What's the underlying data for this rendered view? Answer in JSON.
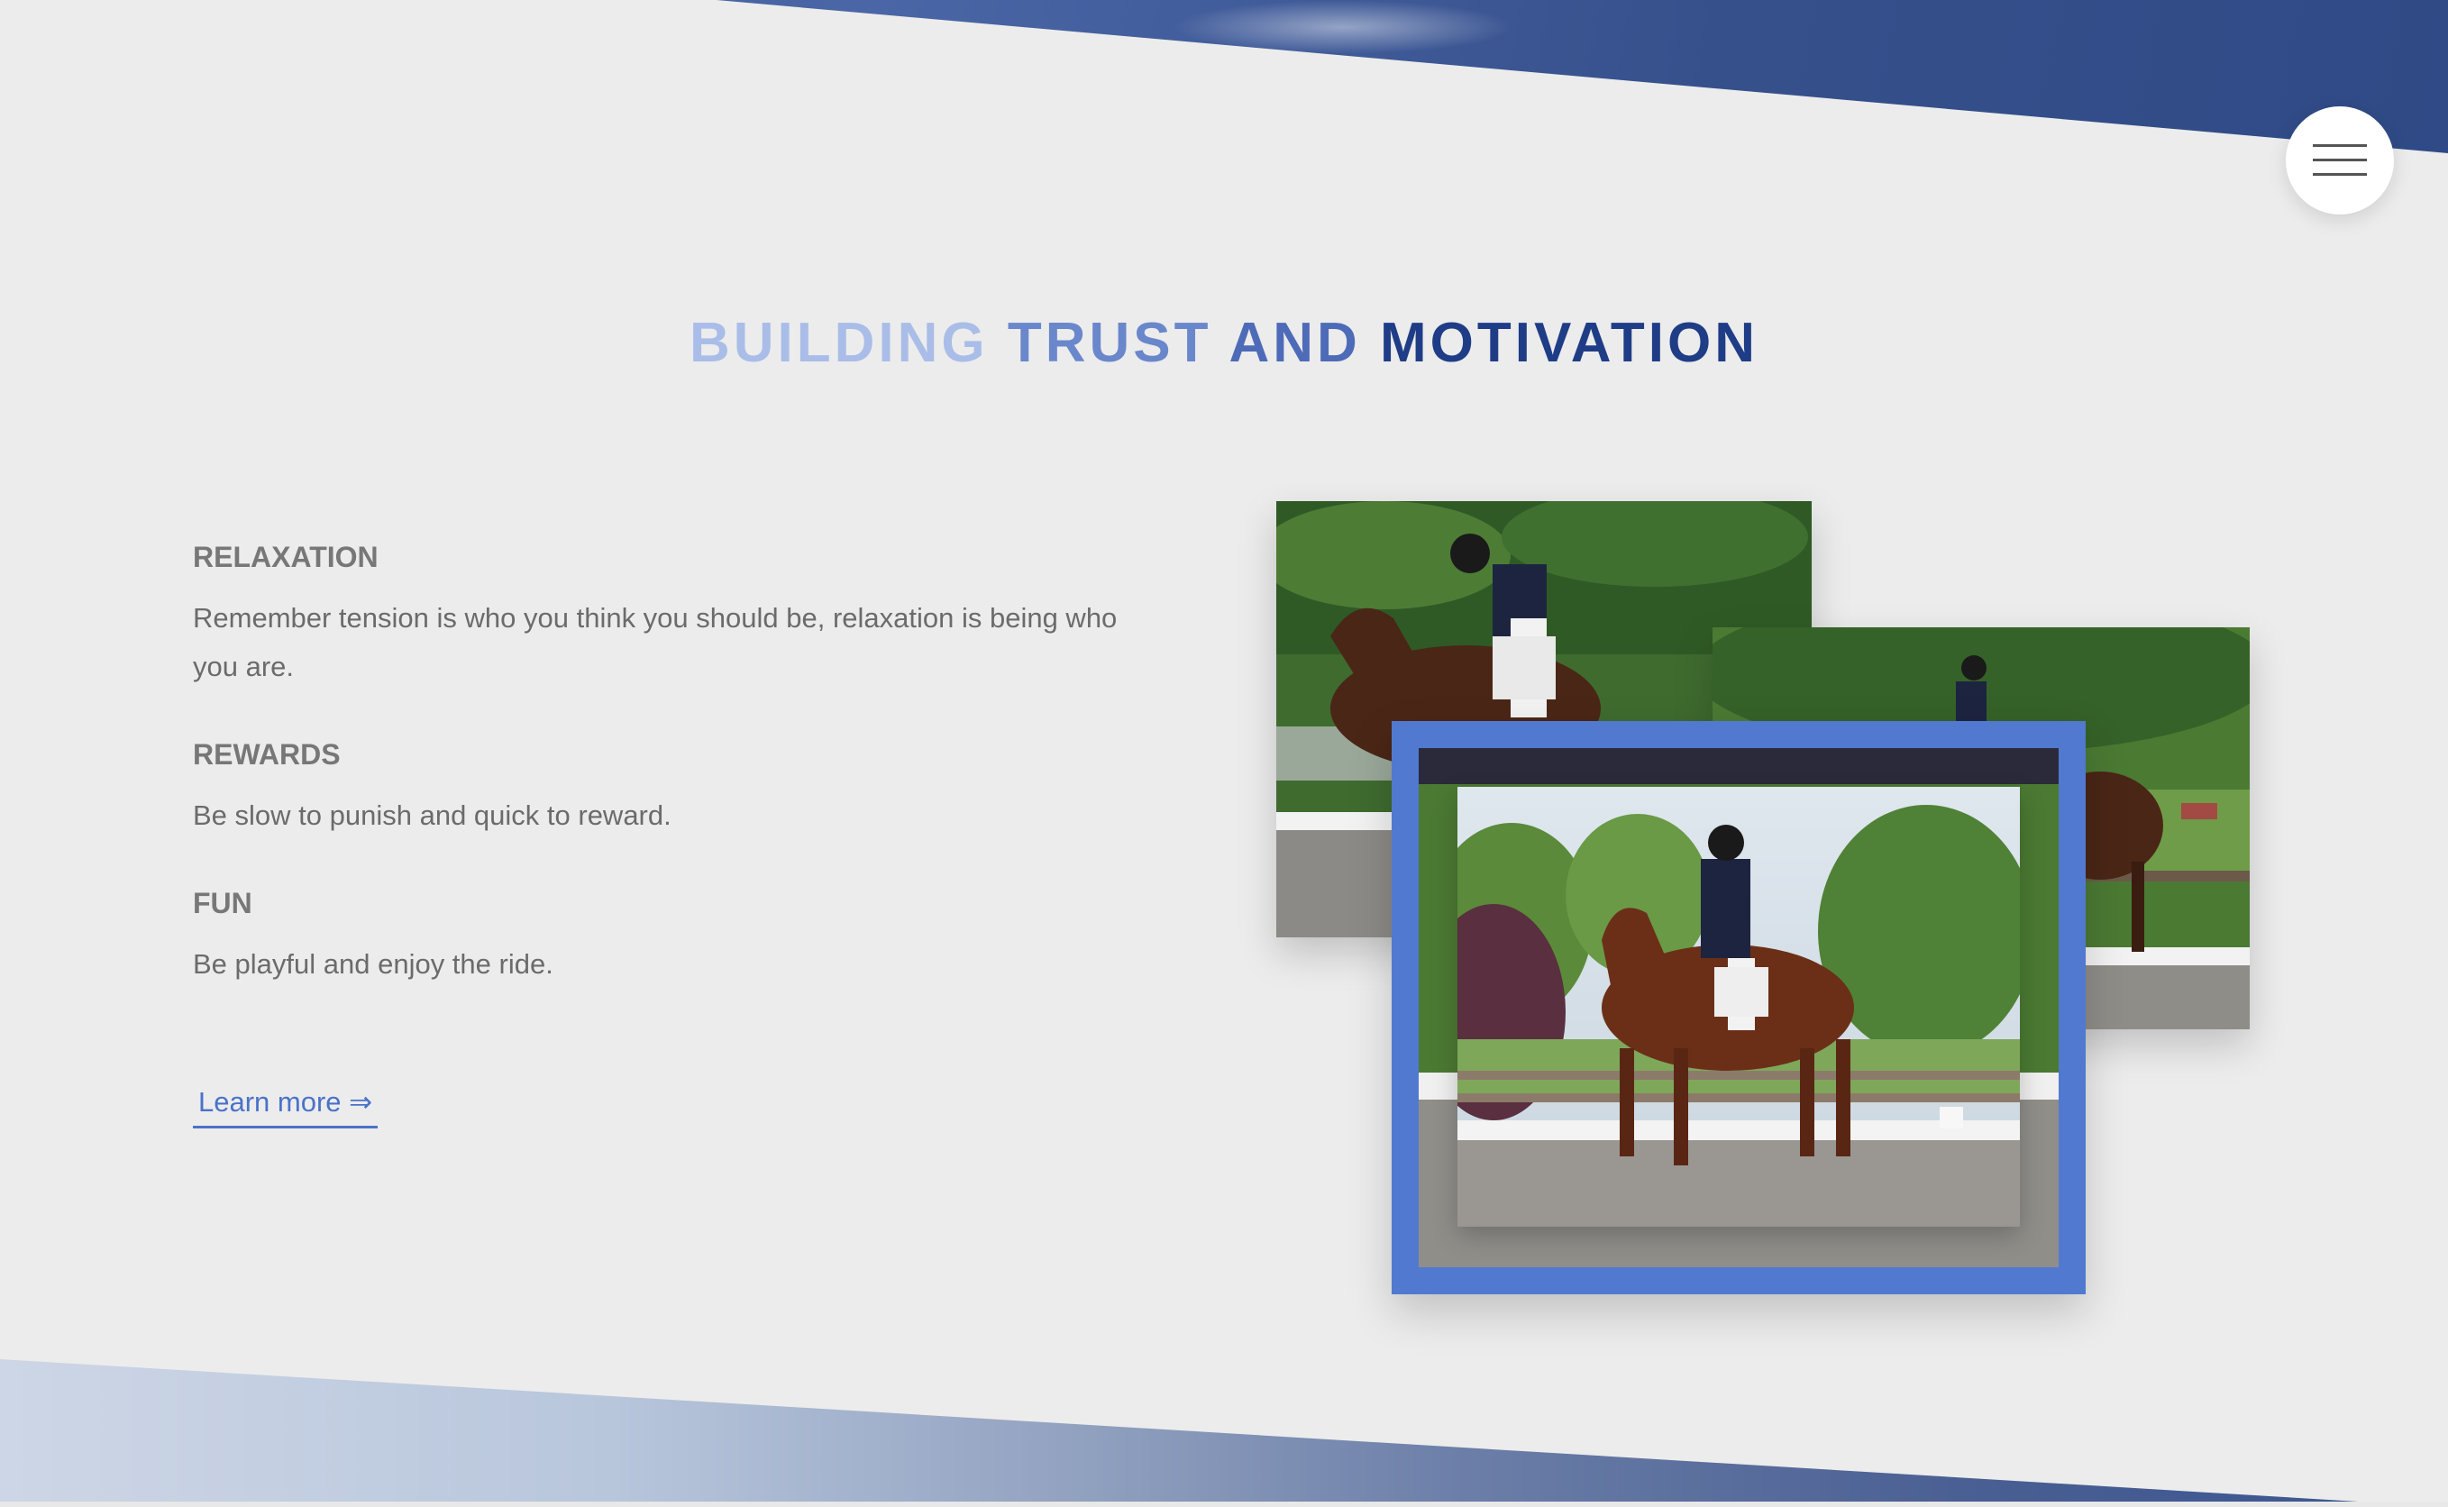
{
  "header": {
    "title_words": [
      "BUILDING",
      "TRUST",
      "AND",
      "MOTIVATION"
    ]
  },
  "menu": {
    "icon": "hamburger-icon"
  },
  "features": [
    {
      "heading": "RELAXATION",
      "text": "Remember tension is who you think you should be, relaxation is being who you are."
    },
    {
      "heading": "REWARDS",
      "text": "Be slow to punish and quick to reward."
    },
    {
      "heading": "FUN",
      "text": "Be playful and enjoy the ride."
    }
  ],
  "cta": {
    "label": "Learn more ⇒"
  },
  "colors": {
    "accent": "#5179cf",
    "title_dark": "#1f3d86",
    "background": "#ececec",
    "link": "#4a72c9"
  }
}
